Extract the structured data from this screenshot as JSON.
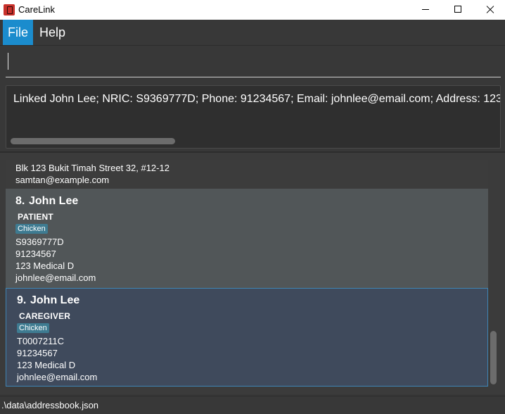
{
  "window": {
    "title": "CareLink",
    "icon": "app-logo-icon"
  },
  "menu": {
    "file": "File",
    "help": "Help",
    "accent": "#1b8ccd"
  },
  "command": {
    "value": ""
  },
  "result": {
    "text": "Linked John Lee; NRIC: S9369777D; Phone: 91234567; Email: johnlee@email.com; Address: 123"
  },
  "persons": [
    {
      "address": "Blk 123 Bukit Timah Street 32, #12-12",
      "email": "samtan@example.com"
    },
    {
      "index": "8.",
      "name": "John Lee",
      "role": "PATIENT",
      "tag": "Chicken",
      "nric": "S9369777D",
      "phone": "91234567",
      "address": "123 Medical D",
      "email": "johnlee@email.com"
    },
    {
      "index": "9.",
      "name": "John Lee",
      "role": "CAREGIVER",
      "tag": "Chicken",
      "nric": "T0007211C",
      "phone": "91234567",
      "address": "123 Medical D",
      "email": "johnlee@email.com"
    }
  ],
  "status": {
    "path": ".\\data\\addressbook.json"
  }
}
